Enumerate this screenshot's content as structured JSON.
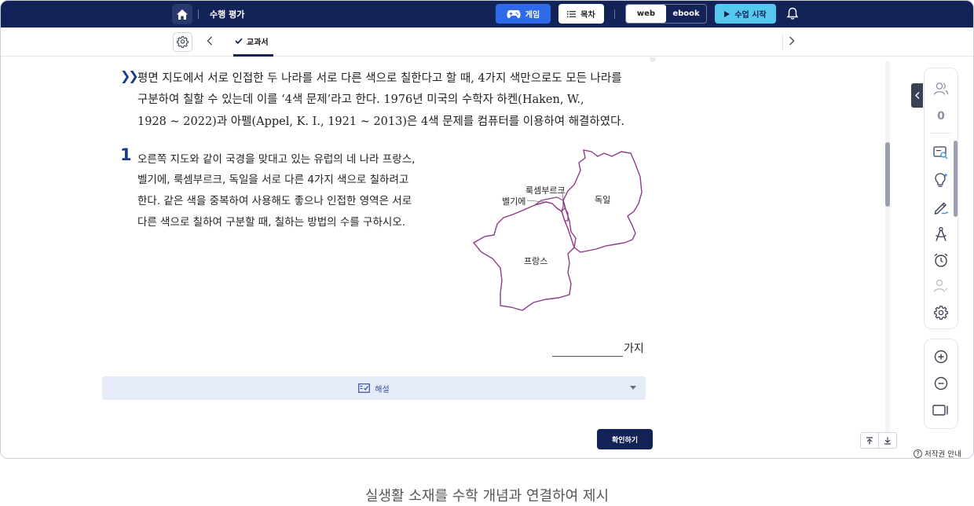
{
  "header": {
    "title": "수행 평가",
    "game_label": "게임",
    "toc_label": "목차",
    "view_web": "web",
    "view_ebook": "ebook",
    "start_label": "수업 시작"
  },
  "subbar": {
    "tab_label": "교과서"
  },
  "content": {
    "intro_lines": [
      "평면 지도에서 서로 인접한 두 나라를 서로 다른 색으로 칠한다고 할 때, 4가지 색만으로도 모든 나라를",
      "구분하여  칠할  수  있는데  이를  ‘4색  문제’라고  한다.  1976년  미국의  수학자  하켄(Haken,  W.,",
      "1928 ~ 2022)과 아펠(Appel, K. I., 1921 ~ 2013)은 4색 문제를 컴퓨터를 이용하여 해결하였다."
    ],
    "question_number": "1",
    "question_lines": [
      "오른쪽  지도와  같이  국경을  맞대고  있는  유럽의  네  나라  프랑스,",
      "벨기에,  룩셈부르크,  독일을  서로  다른  4가지  색으로  칠하려고",
      "한다.  같은  색을  중복하여  사용해도  좋으나  인접한  영역은  서로",
      "다른 색으로 칠하여 구분할 때, 칠하는 방법의 수를 구하시오."
    ],
    "map_labels": {
      "luxembourg": "룩셈부르크",
      "belgium": "벨기에",
      "germany": "독일",
      "france": "프랑스"
    },
    "answer_unit": "가지",
    "explain_label": "해설",
    "confirm_label": "확인하기"
  },
  "rail": {
    "count": "0"
  },
  "footer": {
    "copyright": "저작권 안내",
    "caption": "실생활 소재를 수학 개념과 연결하여 제시"
  },
  "colors": {
    "navy": "#132358",
    "game_blue": "#2f6be8",
    "start_cyan": "#56c8ef",
    "question_blue": "#1b3a8c",
    "map_border": "#8e3a8c",
    "explain_bg": "#e6ebfa"
  }
}
